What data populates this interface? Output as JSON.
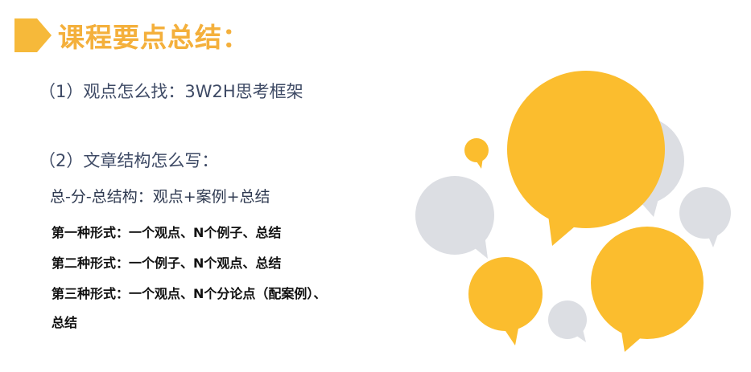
{
  "slide": {
    "title": "课程要点总结：",
    "point1": "（1）观点怎么找：3W2H思考框架",
    "point2": "（2）文章结构怎么写：",
    "structure": "总-分-总结构：观点+案例+总结",
    "forms": [
      "第一种形式：一个观点、N个例子、总结",
      "第二种形式：一个例子、N个观点、总结",
      "第三种形式：一个观点、N个分论点（配案例）、",
      "总结"
    ]
  },
  "colors": {
    "accent": "#F4B03C",
    "bubble_yellow": "#FBBD2E",
    "bubble_gray": "#DCDEE3",
    "text_blue": "#3E4A65",
    "text_black": "#111111"
  },
  "icons": [
    "title-arrow-icon",
    "speech-bubble-icon"
  ]
}
